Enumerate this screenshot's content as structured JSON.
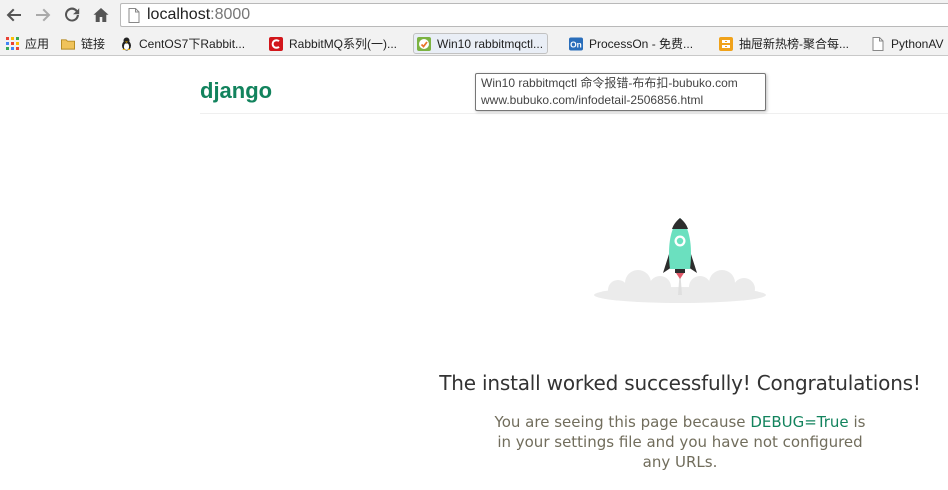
{
  "browser": {
    "url_host": "localhost",
    "url_port": ":8000",
    "icons": {
      "back": "back-arrow-icon",
      "forward": "forward-arrow-icon",
      "reload": "reload-icon",
      "home": "home-icon",
      "page": "page-icon"
    }
  },
  "bookmarks": [
    {
      "label": "应用",
      "icon": "apps-grid-icon"
    },
    {
      "label": "链接",
      "icon": "folder-icon"
    },
    {
      "label": "CentOS7下Rabbit...",
      "icon": "linux-tux-icon"
    },
    {
      "label": "RabbitMQ系列(一)...",
      "icon": "cnblogs-icon"
    },
    {
      "label": "Win10 rabbitmqctl...",
      "icon": "bubuko-icon"
    },
    {
      "label": "ProcessOn - 免费...",
      "icon": "processon-icon"
    },
    {
      "label": "抽屉新热榜-聚合每...",
      "icon": "chouti-icon"
    },
    {
      "label": "PythonAV",
      "icon": "page-icon"
    }
  ],
  "tooltip": {
    "line1": "Win10 rabbitmqctl 命令报错-布布扣-bubuko.com",
    "line2": "www.bubuko.com/infodetail-2506856.html"
  },
  "page": {
    "brand": "django",
    "headline": "The install worked successfully! Congratulations!",
    "sub_before": "You are seeing this page because ",
    "sub_debug": "DEBUG=True",
    "sub_after": " is in your settings file and you have not configured any URLs.",
    "rocket_icon": "rocket-icon",
    "colors": {
      "brand": "#12835d",
      "rocket_body": "#6be0bf",
      "text_muted": "#716d5c"
    }
  }
}
